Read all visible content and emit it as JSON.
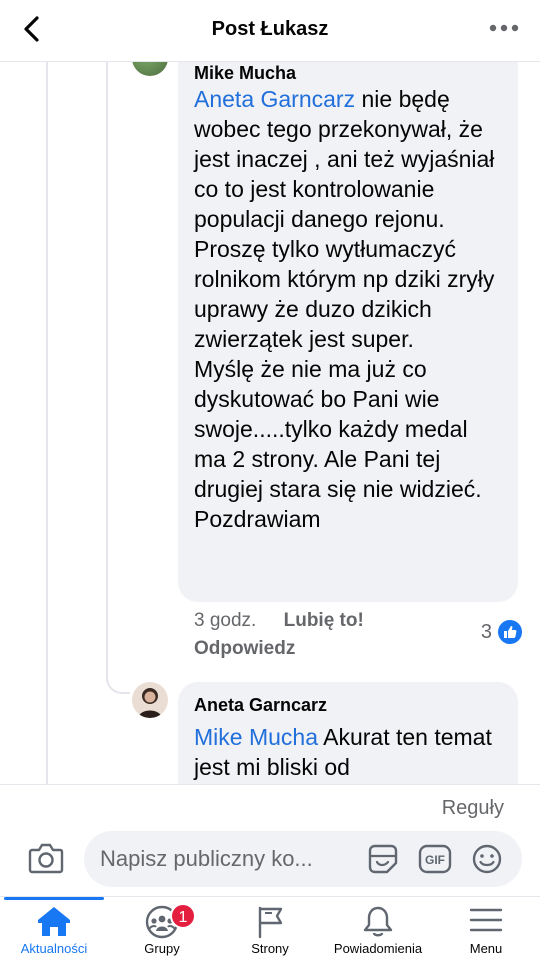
{
  "header": {
    "title": "Post Łukasz",
    "back_icon": "chevron-left-icon",
    "more_icon": "more-horizontal-icon"
  },
  "comment_1": {
    "author": "Mike Mucha",
    "mention": "Aneta Garncarz",
    "text": " nie będę wobec tego przekonywał, że jest inaczej , ani też wyjaśniał co to jest kontrolowanie populacji danego rejonu. Proszę tylko wytłumaczyć rolnikom którym np dziki zryły uprawy że duzo dzikich zwierzątek jest super.\nMyślę że nie ma już co dyskutować bo Pani wie swoje.....tylko każdy medal ma 2 strony. Ale Pani tej drugiej stara się nie widzieć.  Pozdrawiam",
    "time": "3 godz.",
    "like_label": "Lubię to!",
    "reply_label": "Odpowiedz",
    "reaction_count": "3"
  },
  "comment_2": {
    "author": "Aneta Garncarz",
    "mention": "Mike Mucha",
    "text": " Akurat ten temat jest mi bliski od"
  },
  "composer": {
    "rules_label": "Reguły",
    "placeholder": "Napisz publiczny ko..."
  },
  "tabs": [
    {
      "label": "Aktualności",
      "icon": "home-icon",
      "active": true
    },
    {
      "label": "Grupy",
      "icon": "groups-icon",
      "badge": "1"
    },
    {
      "label": "Strony",
      "icon": "flag-icon"
    },
    {
      "label": "Powiadomienia",
      "icon": "bell-icon"
    },
    {
      "label": "Menu",
      "icon": "hamburger-icon"
    }
  ],
  "colors": {
    "accent": "#1877f2",
    "mention": "#216fdb",
    "bubble": "#f0f2f5",
    "badge": "#e41e3f"
  }
}
